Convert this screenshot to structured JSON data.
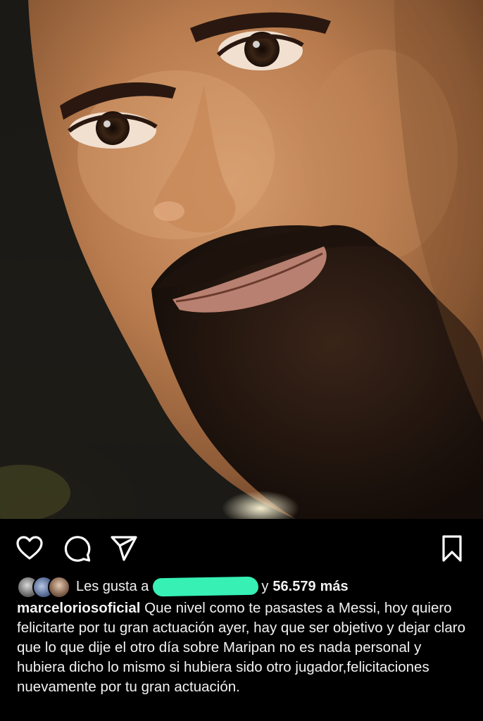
{
  "post": {
    "photo_alt": "photo",
    "actions": {
      "like_icon": "heart-outline-icon",
      "comment_icon": "speech-bubble-icon",
      "share_icon": "paper-plane-icon",
      "save_icon": "bookmark-outline-icon"
    },
    "likes": {
      "prefix": "Les gusta a",
      "and_word": "y",
      "count": "56.579",
      "more": "más"
    },
    "caption": {
      "username": "marceloriosoficial",
      "text": "Que nivel como te pasastes a Messi, hoy quiero felicitarte por tu gran actuación ayer, hay que ser objetivo y dejar claro que lo que dije el otro día sobre Maripan no es nada personal y hubiera dicho lo mismo si hubiera sido otro jugador,felicitaciones nuevamente por tu gran actuación."
    }
  },
  "colors": {
    "background": "#000000",
    "text": "#f2f2f2",
    "redaction": "#36f0b4",
    "icon": "#ffffff"
  }
}
